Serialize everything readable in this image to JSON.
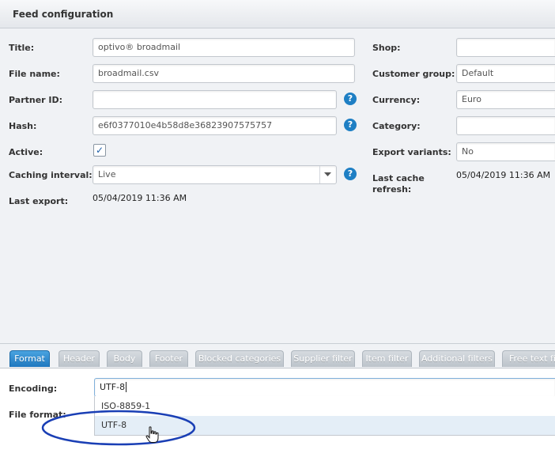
{
  "panel": {
    "title": "Feed configuration"
  },
  "left": {
    "title_label": "Title:",
    "title_value": "optivo® broadmail",
    "filename_label": "File name:",
    "filename_value": "broadmail.csv",
    "partner_label": "Partner ID:",
    "partner_value": "",
    "hash_label": "Hash:",
    "hash_value": "e6f0377010e4b58d8e36823907575757",
    "active_label": "Active:",
    "active_checked": true,
    "caching_label": "Caching interval:",
    "caching_value": "Live",
    "last_export_label": "Last export:",
    "last_export_value": "05/04/2019 11:36 AM",
    "help_glyph": "?"
  },
  "right": {
    "shop_label": "Shop:",
    "shop_value": "",
    "customer_group_label": "Customer group:",
    "customer_group_value": "Default",
    "currency_label": "Currency:",
    "currency_value": "Euro",
    "category_label": "Category:",
    "category_value": "",
    "export_variants_label": "Export variants:",
    "export_variants_value": "No",
    "last_cache_label_1": "Last cache",
    "last_cache_label_2": "refresh:",
    "last_cache_value": "05/04/2019 11:36 AM"
  },
  "tabs": [
    {
      "label": "Format",
      "active": true
    },
    {
      "label": "Header"
    },
    {
      "label": "Body"
    },
    {
      "label": "Footer"
    },
    {
      "label": "Blocked categories"
    },
    {
      "label": "Supplier filter"
    },
    {
      "label": "Item filter"
    },
    {
      "label": "Additional filters"
    },
    {
      "label": "Free text fie"
    }
  ],
  "format": {
    "encoding_label": "Encoding:",
    "encoding_value": "UTF-8",
    "file_format_label": "File format:",
    "encoding_options": [
      "ISO-8859-1",
      "UTF-8"
    ],
    "hovered_option": "UTF-8"
  },
  "colors": {
    "accent": "#1e7fc4",
    "annotation": "#1a3fb5",
    "active_tab": "#2a88cf"
  },
  "icons": {
    "help": "help-circle-icon",
    "cursor": "hand-pointer-icon",
    "dropdown": "chevron-down-icon"
  }
}
